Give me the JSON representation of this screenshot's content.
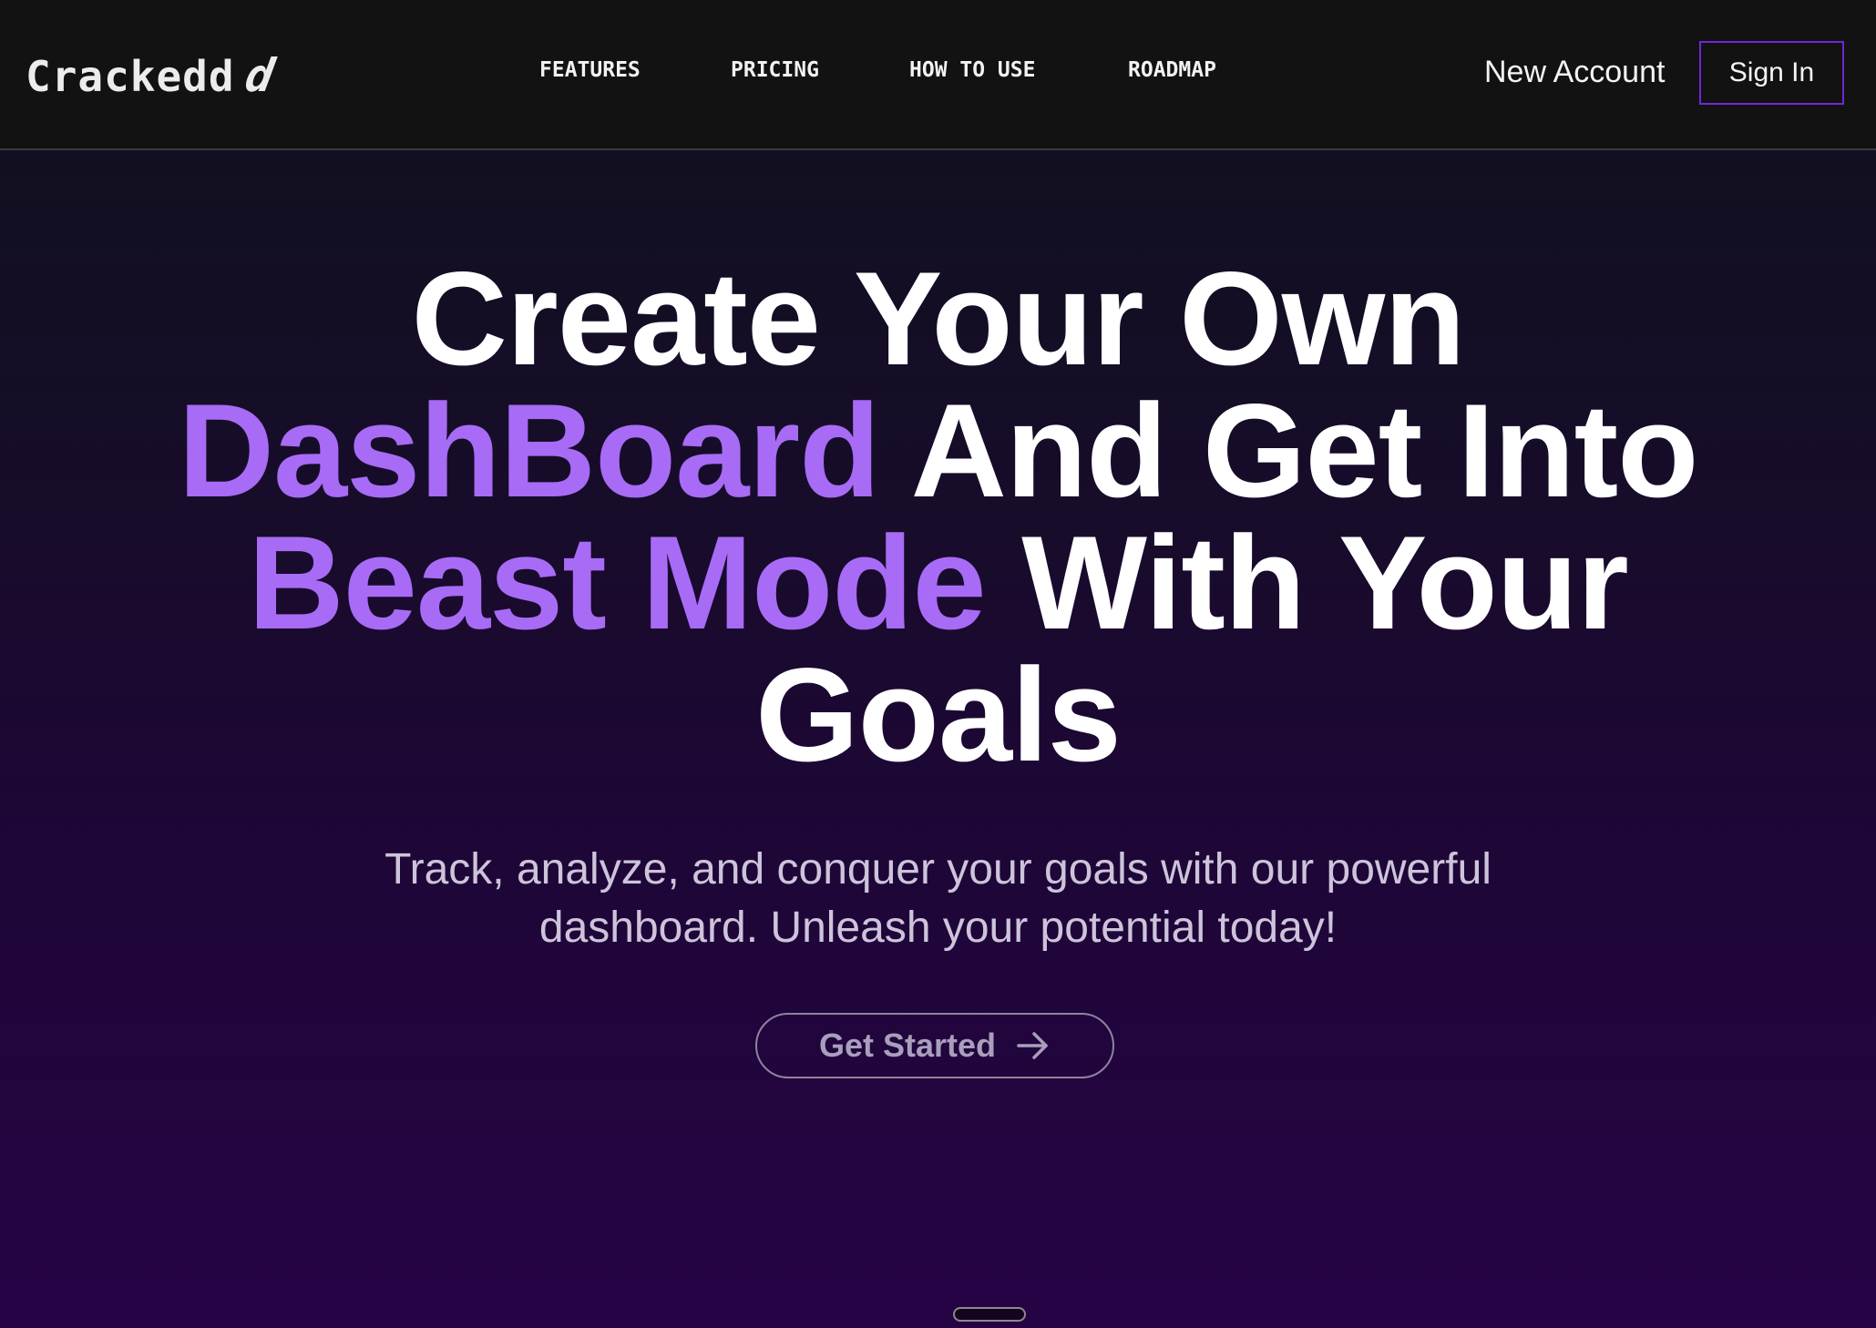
{
  "brand": {
    "name": "Crackedd",
    "mark": "d"
  },
  "nav": {
    "links": [
      {
        "label": "FEATURES"
      },
      {
        "label": "PRICING"
      },
      {
        "label": "HOW TO USE"
      },
      {
        "label": "ROADMAP"
      }
    ],
    "new_account_label": "New Account",
    "sign_in_label": "Sign In"
  },
  "hero": {
    "headline": {
      "line1": "Create Your Own",
      "line2_accent": "DashBoard",
      "line2_rest": " And Get Into",
      "line3_accent": "Beast Mode",
      "line3_rest": " With Your",
      "line4": "Goals"
    },
    "subtitle": {
      "line1": "Track, analyze, and conquer your goals with our powerful",
      "line2": "dashboard. Unleash your potential today!"
    },
    "cta_label": "Get Started",
    "cta_icon": "arrow-right-icon"
  },
  "colors": {
    "accent": "#a86bf5",
    "sign_in_border": "#6d28d9",
    "navbar_bg": "#121212"
  }
}
